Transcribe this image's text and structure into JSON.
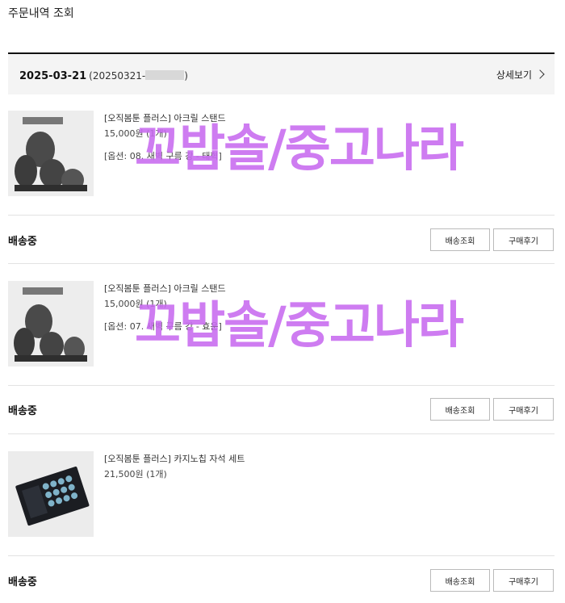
{
  "page": {
    "title": "주문내역 조회"
  },
  "order": {
    "date": "2025-03-21",
    "number_prefix": "(20250321-",
    "number_suffix": ")",
    "detail_label": "상세보기"
  },
  "items": [
    {
      "name": "[오직봄툰 플러스] 아크릴 스탠드",
      "price": "15,000원 (1개)",
      "option": "[옵션: 08. 새벽 구름 강 - 태혁]",
      "status": "배송중",
      "track_label": "배송조회",
      "review_label": "구매후기"
    },
    {
      "name": "[오직봄툰 플러스] 아크릴 스탠드",
      "price": "15,000원 (1개)",
      "option": "[옵션: 07. 새벽 구름 강 - 효운]",
      "status": "배송중",
      "track_label": "배송조회",
      "review_label": "구매후기"
    },
    {
      "name": "[오직봄툰 플러스] 카지노칩 자석 세트",
      "price": "21,500원 (1개)",
      "status": "배송중",
      "track_label": "배송조회",
      "review_label": "구매후기"
    }
  ],
  "watermark": {
    "text": "꼬밥솔/중고나라"
  },
  "colors": {
    "watermark": "#c86af0",
    "header_bg": "#f4f4f4"
  }
}
